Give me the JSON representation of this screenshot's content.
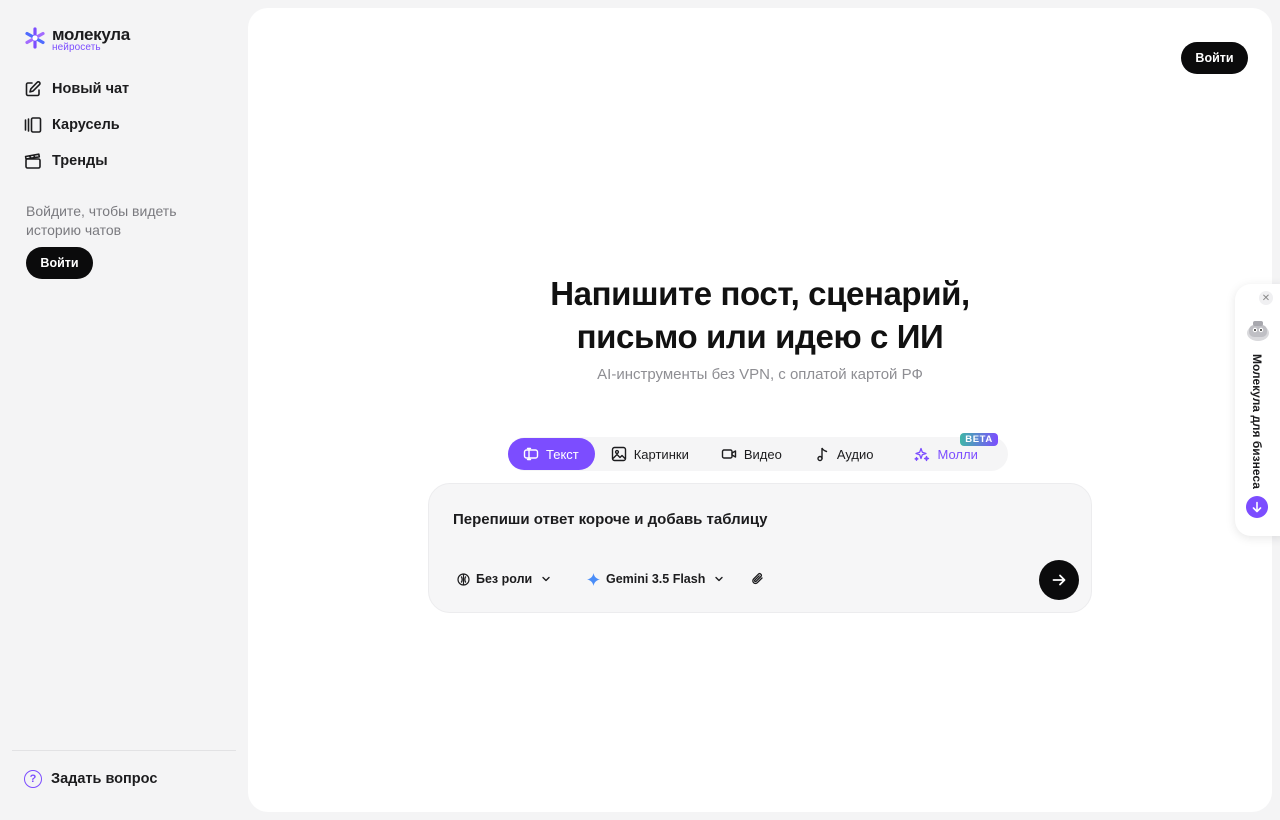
{
  "brand": {
    "name": "молекула",
    "subtitle": "нейросеть"
  },
  "sidebar": {
    "items": [
      {
        "label": "Новый чат",
        "icon": "edit-icon"
      },
      {
        "label": "Карусель",
        "icon": "carousel-icon"
      },
      {
        "label": "Тренды",
        "icon": "clapperboard-icon"
      }
    ],
    "login_hint": "Войдите, чтобы видеть историю чатов",
    "login_label": "Войти",
    "help_label": "Задать вопрос",
    "help_glyph": "?"
  },
  "header": {
    "login_label": "Войти"
  },
  "hero": {
    "title_line1": "Напишите пост, сценарий,",
    "title_line2": "письмо или идею с ИИ",
    "subtitle": "AI-инструменты без VPN, с оплатой картой РФ"
  },
  "tabs": [
    {
      "label": "Текст",
      "icon": "text-icon",
      "active": true
    },
    {
      "label": "Картинки",
      "icon": "image-icon",
      "active": false
    },
    {
      "label": "Видео",
      "icon": "video-icon",
      "active": false
    },
    {
      "label": "Аудио",
      "icon": "music-note-icon",
      "active": false
    },
    {
      "label": "Молли",
      "icon": "sparkle-icon",
      "active": false,
      "badge": "BETA"
    }
  ],
  "composer": {
    "value": "Перепиши ответ короче и добавь таблицу",
    "role_label": "Без роли",
    "model_label": "Gemini 3.5 Flash"
  },
  "business_widget": {
    "label": "Молекула для бизнеса",
    "close_glyph": "✕"
  },
  "colors": {
    "accent": "#7c4dff",
    "dark": "#0b0b0c",
    "background": "#f4f4f5"
  }
}
